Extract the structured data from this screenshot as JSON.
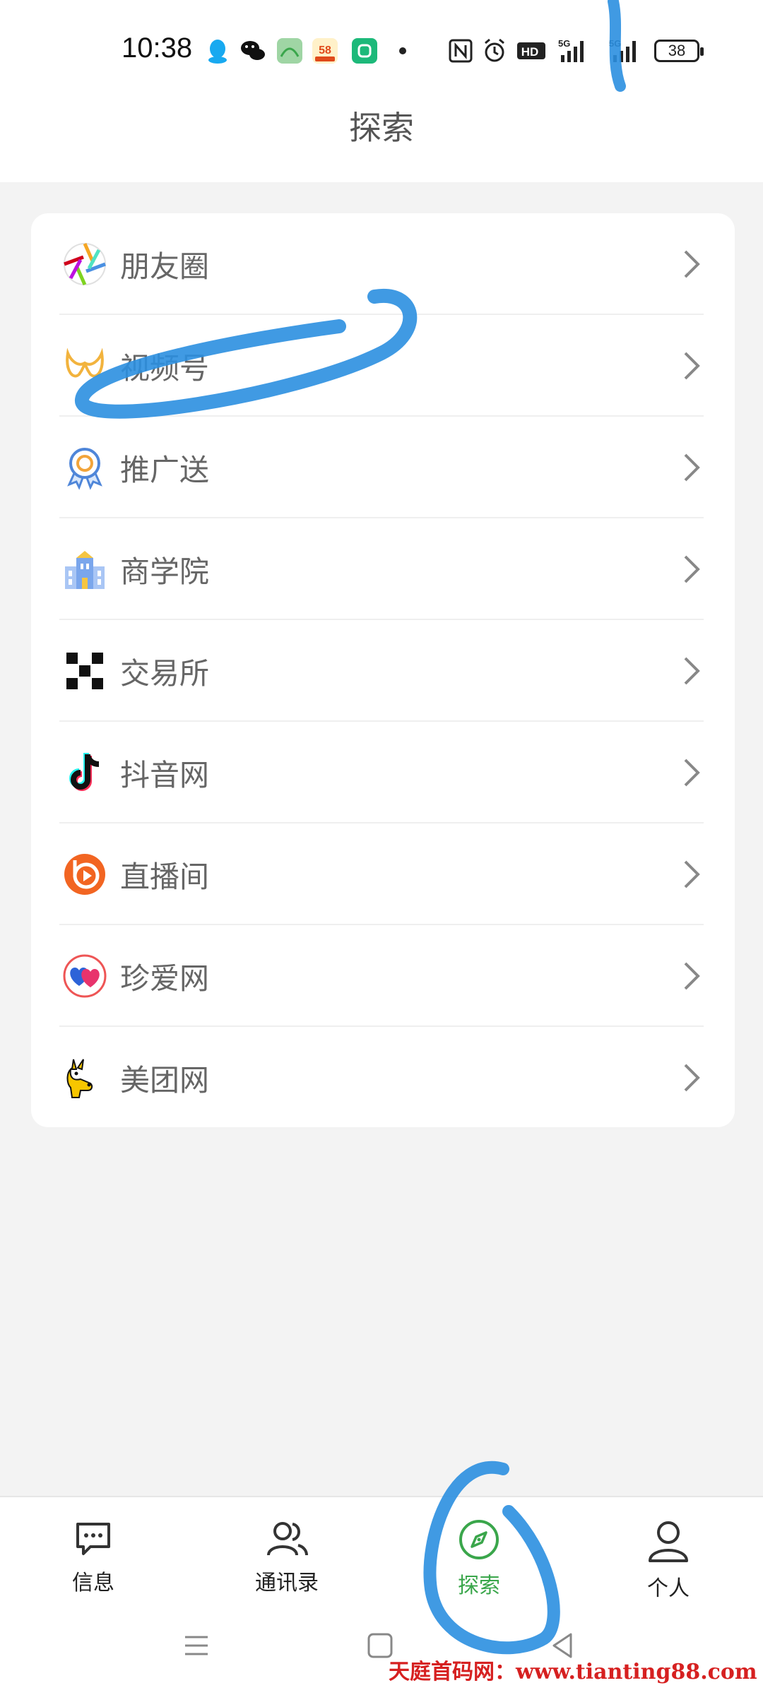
{
  "status_bar": {
    "time": "10:38",
    "battery": "38",
    "apps": [
      "qq-icon",
      "wechat-icon",
      "app-icon",
      "58-icon",
      "shield-icon"
    ],
    "indicators": [
      "nfc-icon",
      "alarm-icon",
      "hd-icon",
      "5g-signal-icon",
      "5g-signal-icon"
    ]
  },
  "header": {
    "title": "探索"
  },
  "menu": {
    "items": [
      {
        "label": "朋友圈",
        "icon": "moments-icon"
      },
      {
        "label": "视频号",
        "icon": "channels-icon"
      },
      {
        "label": "推广送",
        "icon": "award-icon"
      },
      {
        "label": "商学院",
        "icon": "school-icon"
      },
      {
        "label": "交易所",
        "icon": "exchange-icon"
      },
      {
        "label": "抖音网",
        "icon": "tiktok-icon"
      },
      {
        "label": "直播间",
        "icon": "live-icon"
      },
      {
        "label": "珍爱网",
        "icon": "hearts-icon"
      },
      {
        "label": "美团网",
        "icon": "kangaroo-icon"
      }
    ]
  },
  "tabbar": {
    "tabs": [
      {
        "label": "信息",
        "icon": "message-icon"
      },
      {
        "label": "通讯录",
        "icon": "contacts-icon"
      },
      {
        "label": "探索",
        "icon": "compass-icon",
        "active": true
      },
      {
        "label": "个人",
        "icon": "person-icon"
      }
    ]
  },
  "watermark": "天庭首码网：www.tianting88.com",
  "colors": {
    "accent": "#3aa64b",
    "annotation": "#2b8fe0",
    "watermark": "#d62020"
  }
}
